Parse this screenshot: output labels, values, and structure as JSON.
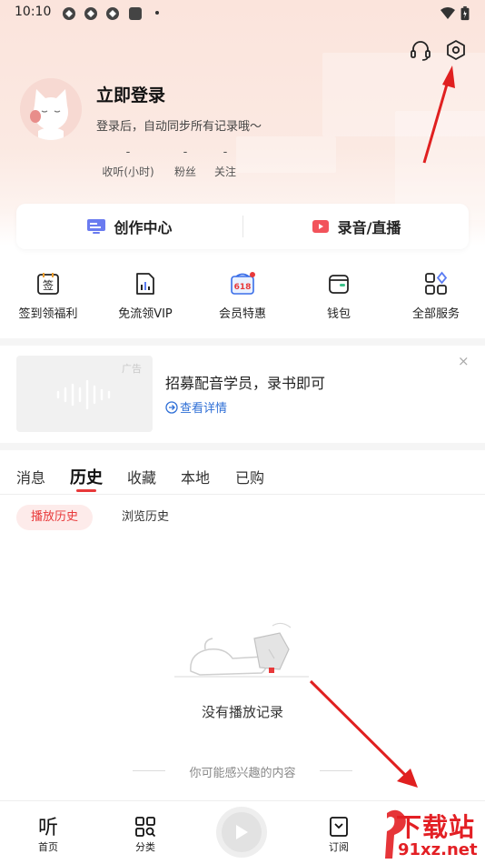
{
  "status_bar": {
    "time": "10:10"
  },
  "header_icons": [
    "headset-icon",
    "settings-hexagon-icon"
  ],
  "profile": {
    "title": "立即登录",
    "subtitle": "登录后，自动同步所有记录哦～",
    "stats": [
      {
        "value": "-",
        "label": "收听(小时)"
      },
      {
        "value": "-",
        "label": "粉丝"
      },
      {
        "value": "-",
        "label": "关注"
      }
    ]
  },
  "create_card": {
    "left": "创作中心",
    "right": "录音/直播"
  },
  "quick_actions": [
    {
      "label": "签到领福利",
      "icon": "checkin-icon"
    },
    {
      "label": "免流领VIP",
      "icon": "data-free-icon"
    },
    {
      "label": "会员特惠",
      "icon": "vip-618-icon",
      "badge_text": "618"
    },
    {
      "label": "钱包",
      "icon": "wallet-icon"
    },
    {
      "label": "全部服务",
      "icon": "all-services-icon"
    }
  ],
  "ad": {
    "tag": "广告",
    "title": "招募配音学员，录书即可",
    "link": "查看详情",
    "close": "×"
  },
  "tabs": [
    {
      "label": "消息",
      "active": false
    },
    {
      "label": "历史",
      "active": true
    },
    {
      "label": "收藏",
      "active": false
    },
    {
      "label": "本地",
      "active": false
    },
    {
      "label": "已购",
      "active": false
    }
  ],
  "sub_tabs": [
    {
      "label": "播放历史",
      "active": true
    },
    {
      "label": "浏览历史",
      "active": false
    }
  ],
  "empty_state": "没有播放记录",
  "recommend_label": "你可能感兴趣的内容",
  "bottom_nav": [
    {
      "label": "首页",
      "icon": "home-ting-icon"
    },
    {
      "label": "分类",
      "icon": "category-icon"
    },
    {
      "label": "订阅",
      "icon": "subscribe-icon"
    }
  ],
  "watermark": {
    "line1": "下载站",
    "line2": "91xz.net"
  },
  "colors": {
    "accent": "#e8393a",
    "link": "#2f6fd6",
    "annotation": "#e02020"
  }
}
